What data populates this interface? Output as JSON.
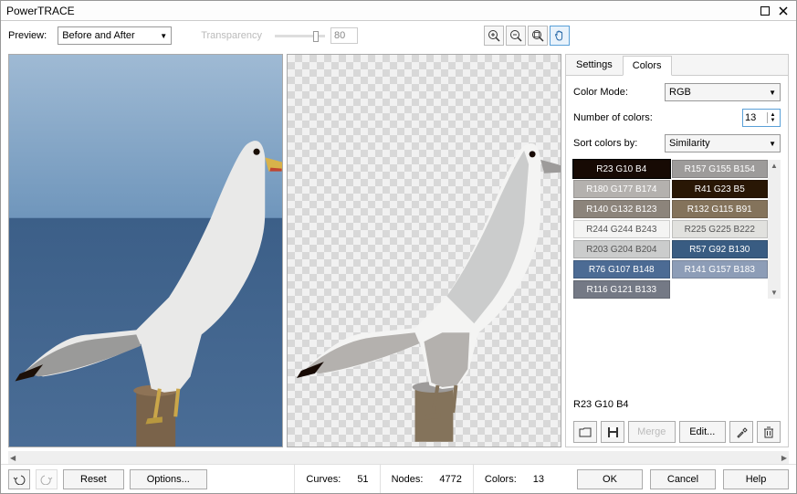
{
  "window": {
    "title": "PowerTRACE"
  },
  "topbar": {
    "preview_label": "Preview:",
    "preview_value": "Before and After",
    "transparency_label": "Transparency",
    "slider_value": "80"
  },
  "tabs": {
    "settings": "Settings",
    "colors": "Colors"
  },
  "colors_panel": {
    "color_mode_label": "Color Mode:",
    "color_mode_value": "RGB",
    "num_colors_label": "Number of colors:",
    "num_colors_value": "13",
    "sort_label": "Sort colors by:",
    "sort_value": "Similarity"
  },
  "swatches_left": [
    {
      "label": "R23 G10 B4",
      "bg": "#170a04",
      "fg": "#ffffff"
    },
    {
      "label": "R180 G177 B174",
      "bg": "#b4b1ae",
      "fg": "#ffffff"
    },
    {
      "label": "R140 G132 B123",
      "bg": "#8c847b",
      "fg": "#ffffff"
    },
    {
      "label": "R244 G244 B243",
      "bg": "#f4f4f3",
      "fg": "#555555"
    },
    {
      "label": "R203 G204 B204",
      "bg": "#cbcccc",
      "fg": "#555555"
    },
    {
      "label": "R76 G107 B148",
      "bg": "#4c6b94",
      "fg": "#ffffff"
    },
    {
      "label": "R116 G121 B133",
      "bg": "#747985",
      "fg": "#ffffff"
    }
  ],
  "swatches_right": [
    {
      "label": "R157 G155 B154",
      "bg": "#9d9b9a",
      "fg": "#ffffff"
    },
    {
      "label": "R41 G23 B5",
      "bg": "#291705",
      "fg": "#ffffff"
    },
    {
      "label": "R132 G115 B91",
      "bg": "#84735b",
      "fg": "#ffffff"
    },
    {
      "label": "R225 G225 B222",
      "bg": "#e1e1de",
      "fg": "#555555"
    },
    {
      "label": "R57 G92 B130",
      "bg": "#395c82",
      "fg": "#ffffff"
    },
    {
      "label": "R141 G157 B183",
      "bg": "#8d9db7",
      "fg": "#ffffff"
    }
  ],
  "selected_swatch": "R23 G10 B4",
  "color_btns": {
    "merge": "Merge",
    "edit": "Edit..."
  },
  "bottom": {
    "reset": "Reset",
    "options": "Options...",
    "curves_label": "Curves:",
    "curves_value": "51",
    "nodes_label": "Nodes:",
    "nodes_value": "4772",
    "colors_label": "Colors:",
    "colors_value": "13",
    "ok": "OK",
    "cancel": "Cancel",
    "help": "Help"
  }
}
